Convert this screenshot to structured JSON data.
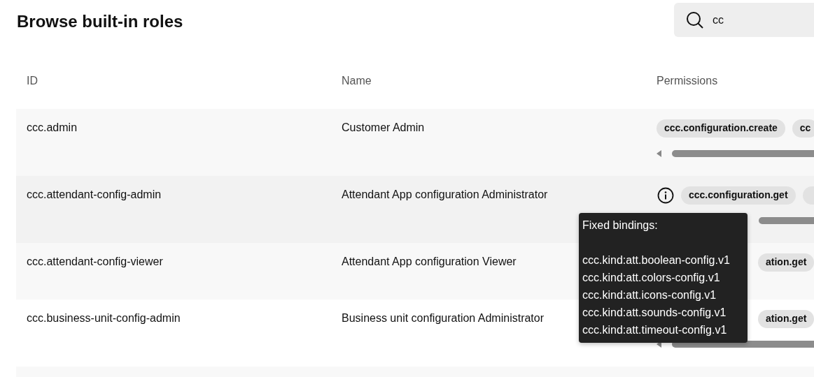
{
  "title": "Browse built-in roles",
  "search": {
    "value": "cc"
  },
  "table": {
    "columns": [
      "ID",
      "Name",
      "Permissions"
    ],
    "rows": [
      {
        "id": "ccc.admin",
        "name": "Customer Admin",
        "info": false,
        "scrollable": true,
        "more_tag": false,
        "permissions": [
          "ccc.configuration.create",
          "cc"
        ]
      },
      {
        "id": "ccc.attendant-config-admin",
        "name": "Attendant App configuration Administrator",
        "info": true,
        "scrollable": true,
        "more_tag": true,
        "permissions": [
          "ccc.configuration.get"
        ]
      },
      {
        "id": "ccc.attendant-config-viewer",
        "name": "Attendant App configuration Viewer",
        "info": false,
        "scrollable": false,
        "more_tag": false,
        "permissions": [
          "ation.get"
        ]
      },
      {
        "id": "ccc.business-unit-config-admin",
        "name": "Business unit configuration Administrator",
        "info": false,
        "scrollable": true,
        "more_tag": false,
        "permissions": [
          "ation.get"
        ]
      }
    ]
  },
  "tooltip": {
    "title": "Fixed bindings:",
    "lines": [
      "ccc.kind:att.boolean-config.v1",
      "ccc.kind:att.colors-config.v1",
      "ccc.kind:att.icons-config.v1",
      "ccc.kind:att.sounds-config.v1",
      "ccc.kind:att.timeout-config.v1"
    ]
  }
}
